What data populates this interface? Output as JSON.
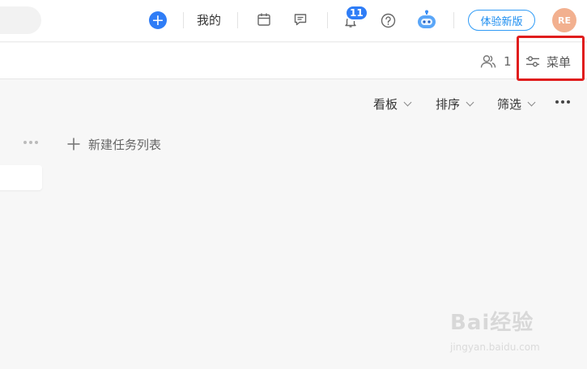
{
  "topbar": {
    "mine_label": "我的",
    "notification_count": "11",
    "try_new_label": "体验新版",
    "avatar_initials": "RE",
    "accent_color": "#2f7df6"
  },
  "subbar": {
    "member_count": "1",
    "menu_label": "菜单"
  },
  "viewbar": {
    "board_label": "看板",
    "sort_label": "排序",
    "filter_label": "筛选"
  },
  "board": {
    "new_list_label": "新建任务列表"
  },
  "watermark": {
    "logo_text": "Bai经验",
    "sub_text": "jingyan.baidu.com"
  }
}
